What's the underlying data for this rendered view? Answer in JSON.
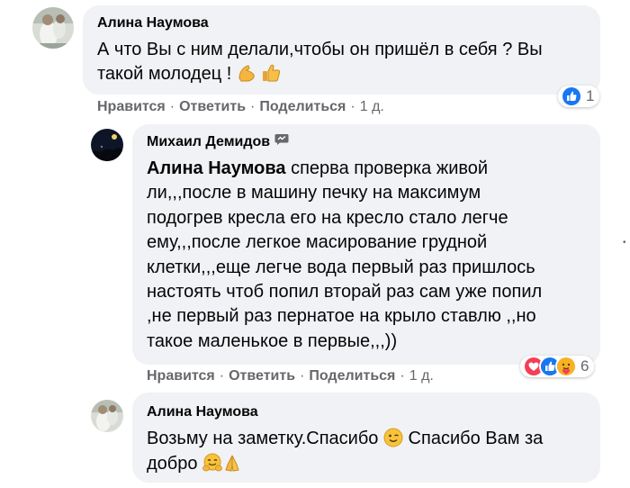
{
  "comments": [
    {
      "author": "Алина Наумова",
      "lines": [
        "А что Вы с ним делали,чтобы он пришёл в себя ? Вы",
        "такой молодец !"
      ],
      "emoji": [
        "flexed-biceps-emoji",
        "thumbs-up-emoji"
      ],
      "actions": {
        "like": "Нравится",
        "reply": "Ответить",
        "share": "Поделиться",
        "time": "1 д."
      },
      "reactions": {
        "icons": [
          "like-reaction-icon"
        ],
        "count": "1"
      }
    },
    {
      "author": "Михаил Демидов",
      "author_badge": "messenger-icon",
      "mention": "Алина Наумова",
      "first_line_rest": " сперва проверка живой",
      "lines": [
        "ли,,,после в машину печку на максимум",
        "подогрев кресла его на кресло стало легче",
        "ему,,,после легкое масирование грудной",
        "клетки,,,еще легче вода первый раз пришлось",
        "настоять чтоб попил вторай раз сам уже попил",
        ",не первый раз пернатое на крыло ставлю ,,но",
        "такое маленькое в первые,,,))"
      ],
      "actions": {
        "like": "Нравится",
        "reply": "Ответить",
        "share": "Поделиться",
        "time": "1 д."
      },
      "reactions": {
        "icons": [
          "love-reaction-icon",
          "like-reaction-icon",
          "care-reaction-icon"
        ],
        "count": "6"
      }
    },
    {
      "author": "Алина Наумова",
      "line1": "Возьму на заметку.Спасибо",
      "line1_rest": " Спасибо Вам за",
      "line2": "добро",
      "emoji": [
        "winking-face-emoji",
        "hugging-face-emoji",
        "folded-hands-emoji"
      ]
    }
  ],
  "colors": {
    "bubble": "#f0f2f5",
    "meta": "#65676b",
    "like_blue": "#1877f2",
    "love_red": "#f33e58",
    "care_yellow": "#f7b125"
  }
}
